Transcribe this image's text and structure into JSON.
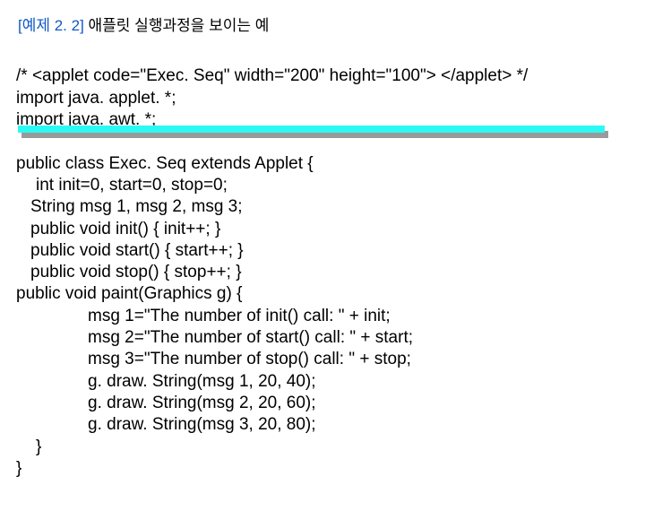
{
  "heading": {
    "prefix": "[예제 2. 2] ",
    "rest": "애플릿 실행과정을 보이는 예"
  },
  "code": {
    "l1": "/* <applet code=\"Exec. Seq\" width=\"200\" height=\"100\"> </applet> */",
    "l2": "import java. applet. *;",
    "l3": "import java. awt. *;",
    "l4": "public class Exec. Seq extends Applet {",
    "l5": "int init=0, start=0, stop=0;",
    "l6": "String msg 1, msg 2, msg 3;",
    "l7": "public void init() { init++; }",
    "l8": "public void start() { start++; }",
    "l9": "public void stop() { stop++; }",
    "l10": "public void paint(Graphics g) {",
    "l11": "msg 1=\"The number of init() call: \" + init;",
    "l12": "msg 2=\"The number of start() call: \" + start;",
    "l13": "msg 3=\"The number of stop() call: \" + stop;",
    "l14": "g. draw. String(msg 1, 20, 40);",
    "l15": "g. draw. String(msg 2, 20, 60);",
    "l16": "g. draw. String(msg 3, 20, 80);",
    "l17": "}",
    "l18": "}"
  }
}
